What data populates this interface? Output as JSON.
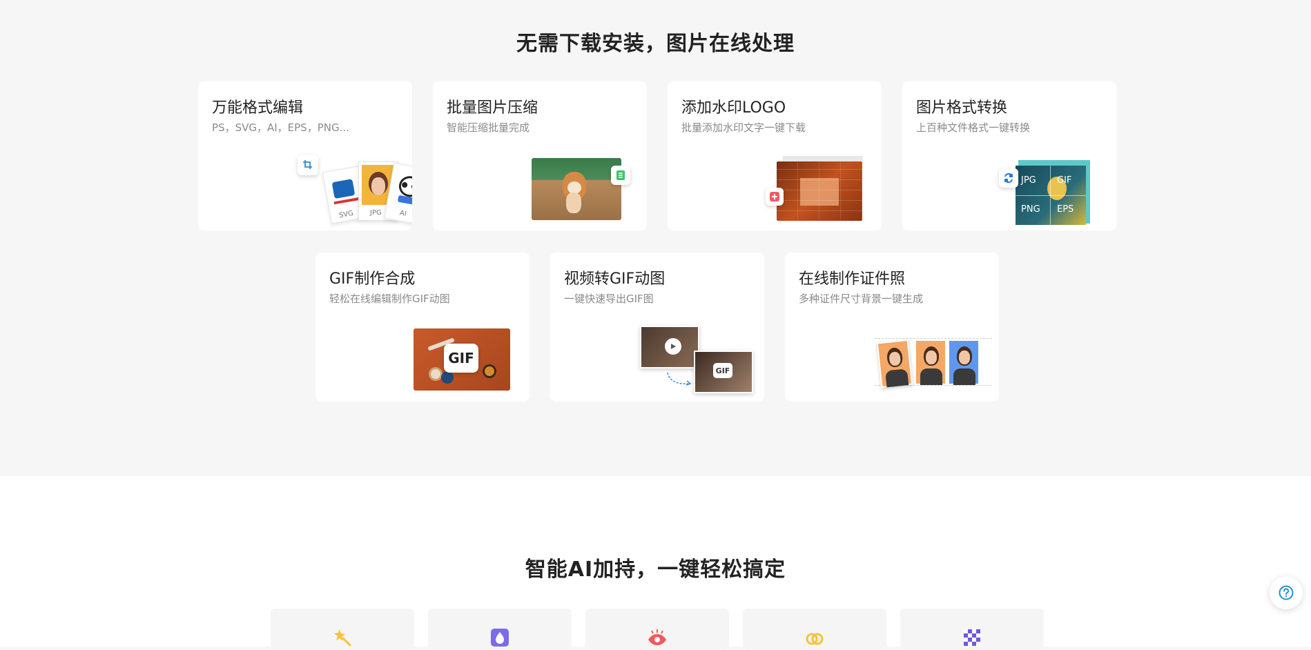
{
  "section1": {
    "title": "无需下载安装，图片在线处理",
    "cards": [
      {
        "title": "万能格式编辑",
        "desc": "PS，SVG，AI，EPS，PNG...",
        "labels": [
          "SVG",
          "JPG",
          "AI"
        ]
      },
      {
        "title": "批量图片压缩",
        "desc": "智能压缩批量完成"
      },
      {
        "title": "添加水印LOGO",
        "desc": "批量添加水印文字一键下载"
      },
      {
        "title": "图片格式转换",
        "desc": "上百种文件格式一键转换",
        "labels": [
          "JPG",
          "GIF",
          "PNG",
          "EPS"
        ]
      },
      {
        "title": "GIF制作合成",
        "desc": "轻松在线编辑制作GIF动图",
        "labels": [
          "GIF"
        ]
      },
      {
        "title": "视频转GIF动图",
        "desc": "一键快速导出GIF图",
        "labels": [
          "GIF"
        ]
      },
      {
        "title": "在线制作证件照",
        "desc": "多种证件尺寸背景一键生成"
      }
    ]
  },
  "section2": {
    "title": "智能AI加持，一键轻松搞定",
    "icons": [
      "magic-wand-icon",
      "drop-icon",
      "eye-icon",
      "rings-icon",
      "checker-icon"
    ]
  },
  "help": {
    "icon": "help-circle-icon"
  },
  "colors": {
    "accent": "#1e90d6",
    "bg_top": "#f6f6f6",
    "bg_bottom": "#ffffff"
  }
}
